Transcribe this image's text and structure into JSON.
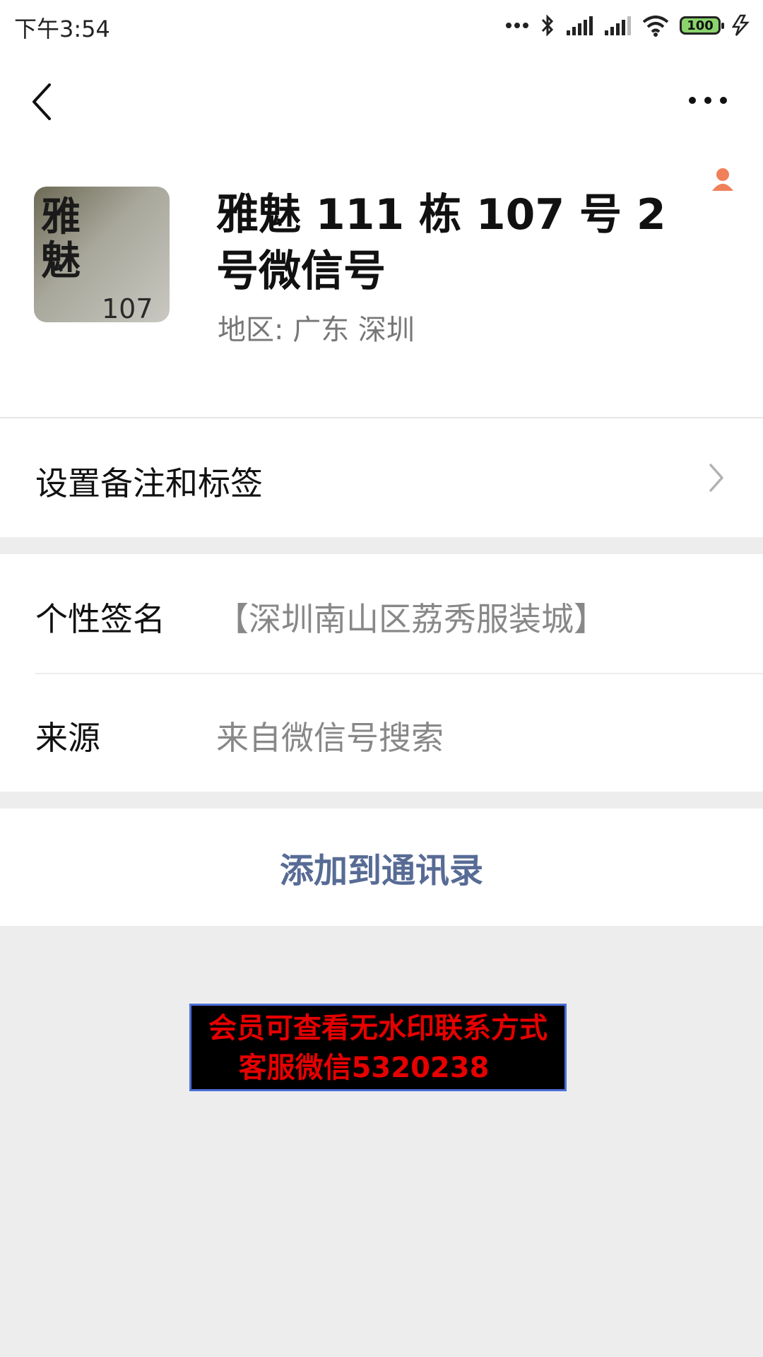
{
  "status_bar": {
    "time": "下午3:54",
    "battery": "100",
    "icons": [
      "more-dots-icon",
      "bluetooth-icon",
      "signal-icon",
      "signal-icon",
      "wifi-icon",
      "battery-icon",
      "charging-icon"
    ]
  },
  "header": {
    "back_icon": "chevron-left-icon",
    "more_icon": "more-horizontal-icon"
  },
  "profile": {
    "name": "雅魅 111 栋 107 号 2 号微信号",
    "region": "地区:  广东  深圳",
    "avatar_text": {
      "line1": "雅",
      "line2": "魅",
      "line3": "107"
    },
    "badge_icon": "person-badge-icon"
  },
  "rows": {
    "remark_label": "设置备注和标签",
    "signature_label": "个性签名",
    "signature_value": "【深圳南山区荔秀服装城】",
    "source_label": "来源",
    "source_value": "来自微信号搜索"
  },
  "actions": {
    "add_contact": "添加到通讯录"
  },
  "watermark": {
    "line1": "会员可查看无水印联系方式",
    "line2": "客服微信5320238"
  },
  "colors": {
    "link": "#576b95",
    "background": "#ededed",
    "watermark_text": "#e60000",
    "badge": "#f0805a"
  }
}
